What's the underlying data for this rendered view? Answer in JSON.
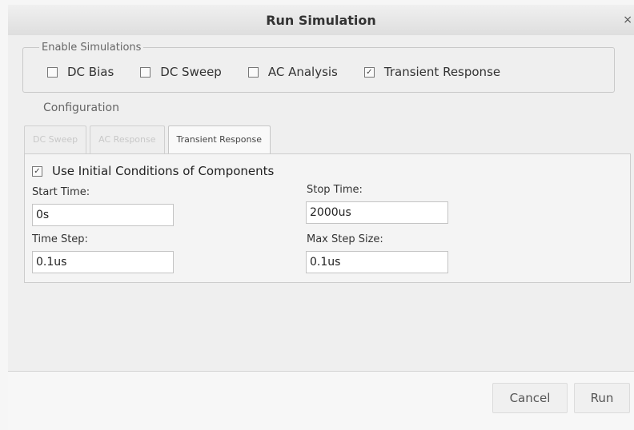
{
  "dialog": {
    "title": "Run Simulation",
    "close_glyph": "×"
  },
  "enable": {
    "legend": "Enable Simulations",
    "options": [
      {
        "label": "DC Bias",
        "checked": false
      },
      {
        "label": "DC Sweep",
        "checked": false
      },
      {
        "label": "AC Analysis",
        "checked": false
      },
      {
        "label": "Transient Response",
        "checked": true
      }
    ]
  },
  "configuration": {
    "label": "Configuration",
    "tabs": [
      {
        "label": "DC Sweep",
        "enabled": false
      },
      {
        "label": "AC Response",
        "enabled": false
      },
      {
        "label": "Transient Response",
        "enabled": true,
        "active": true
      }
    ],
    "transient": {
      "use_initial_conditions": {
        "label": "Use Initial Conditions of Components",
        "checked": true
      },
      "start_time": {
        "label": "Start Time:",
        "value": "0s"
      },
      "stop_time": {
        "label": "Stop Time:",
        "value": "2000us"
      },
      "time_step": {
        "label": "Time Step:",
        "value": "0.1us"
      },
      "max_step_size": {
        "label": "Max Step Size:",
        "value": "0.1us"
      }
    }
  },
  "footer": {
    "cancel_label": "Cancel",
    "run_label": "Run"
  },
  "icons": {
    "checkbox_checked": "☑",
    "checkbox_unchecked": "☐"
  }
}
